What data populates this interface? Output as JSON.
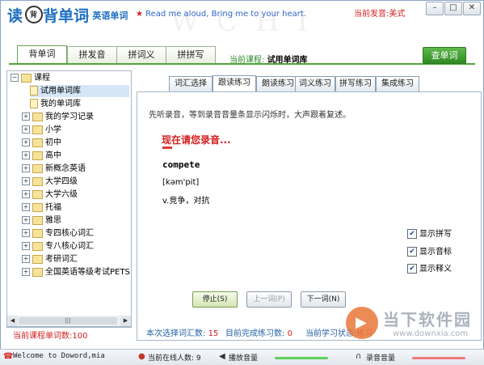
{
  "app": {
    "logo_read": "读",
    "logo_badge": "背",
    "logo_main": "背单词",
    "logo_sub": "– 英语单词",
    "slogan_star": "★",
    "slogan": "Read me aloud, Bring me to your heart.",
    "watermark": "WCHI",
    "accent_label": "当前发音:美式",
    "window_buttons": [
      "–",
      "□",
      "✕"
    ]
  },
  "main_tabs": [
    "背单词",
    "拼发音",
    "拼词义",
    "拼拼写"
  ],
  "current_course_label": "当前课程:",
  "current_course_name": "试用单词库",
  "lookup_button": "查单词",
  "tree": {
    "root": "课程",
    "items": [
      {
        "label": "试用单词库",
        "type": "doc",
        "selected": true
      },
      {
        "label": "我的单词库",
        "type": "doc",
        "selected": false
      },
      {
        "label": "我的学习记录",
        "type": "folder",
        "selected": false
      },
      {
        "label": "小学",
        "type": "folder",
        "selected": false
      },
      {
        "label": "初中",
        "type": "folder",
        "selected": false
      },
      {
        "label": "高中",
        "type": "folder",
        "selected": false
      },
      {
        "label": "新概念英语",
        "type": "folder",
        "selected": false
      },
      {
        "label": "大学四级",
        "type": "folder",
        "selected": false
      },
      {
        "label": "大学六级",
        "type": "folder",
        "selected": false
      },
      {
        "label": "托福",
        "type": "folder",
        "selected": false
      },
      {
        "label": "雅思",
        "type": "folder",
        "selected": false
      },
      {
        "label": "专四核心词汇",
        "type": "folder",
        "selected": false
      },
      {
        "label": "专八核心词汇",
        "type": "folder",
        "selected": false
      },
      {
        "label": "考研词汇",
        "type": "folder",
        "selected": false
      },
      {
        "label": "全国英语等级考试PETS",
        "type": "folder",
        "selected": false
      }
    ],
    "scroll_thumb": "|||"
  },
  "course_word_count": "当前课程单词数:100",
  "sub_tabs": [
    "词汇选择",
    "跟读练习",
    "朗读练习",
    "词义练习",
    "拼写练习",
    "集成练习"
  ],
  "practice": {
    "instruction": "先听录音，等到录音音量条显示闪烁时，大声跟着复述。",
    "record_prompt": "现在请您录音...",
    "word": "compete",
    "phonetic": "[kəm'pit]",
    "meaning": "v.竞争，对抗"
  },
  "options": [
    {
      "label": "显示拼写",
      "checked": true
    },
    {
      "label": "显示音标",
      "checked": true
    },
    {
      "label": "显示释义",
      "checked": true
    }
  ],
  "buttons": {
    "stop": "停止(S)",
    "prev": "上一词(P)",
    "next": "下一词(N)"
  },
  "stats": {
    "selected_label": "本次选择词汇数:",
    "selected_value": "15",
    "done_label": "目前完成练习数:",
    "done_value": "0",
    "status_label": "当前学习状态:",
    "status_value": "练习"
  },
  "statusbar": {
    "welcome": "Welcome to Doword,mia",
    "online_label": "当前在线人数:",
    "online_value": "9",
    "play_volume": "播放音量",
    "record_volume": "录音音量"
  },
  "brand": {
    "name": "当下软件园",
    "url": "www.downxia.com"
  },
  "colors": {
    "accent_green": "#55a23a",
    "highlight_red": "#d41f1f",
    "link_blue": "#2563a8",
    "play_slider": "#5fd05a",
    "record_slider": "#f07a7a"
  }
}
